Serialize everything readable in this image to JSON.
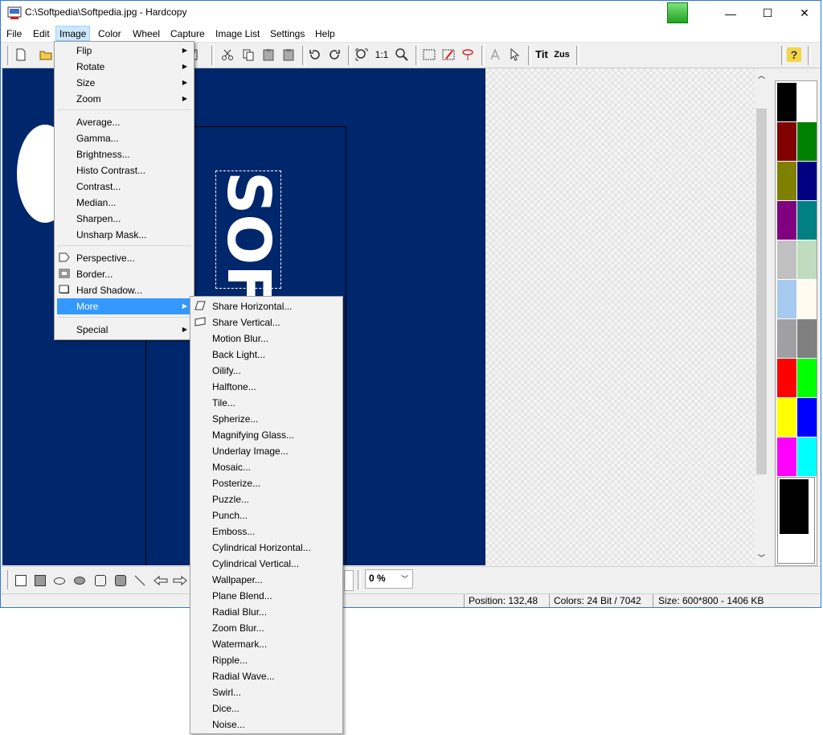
{
  "window": {
    "title": "C:\\Softpedia\\Softpedia.jpg - Hardcopy",
    "minimize": "—",
    "maximize": "☐",
    "close": "✕"
  },
  "menubar": [
    "File",
    "Edit",
    "Image",
    "Color",
    "Wheel",
    "Capture",
    "Image List",
    "Settings",
    "Help"
  ],
  "toolbar": {
    "zoom_1_1": "1:1",
    "tit_label": "Tit",
    "zus_label": "Zus",
    "help_icon": "?"
  },
  "image_menu": {
    "group1": [
      "Flip",
      "Rotate",
      "Size",
      "Zoom"
    ],
    "group2": [
      "Average...",
      "Gamma...",
      "Brightness...",
      "Histo Contrast...",
      "Contrast...",
      "Median...",
      "Sharpen...",
      "Unsharp Mask..."
    ],
    "group3": [
      "Perspective...",
      "Border...",
      "Hard Shadow...",
      "More"
    ],
    "group4": [
      "Special"
    ]
  },
  "more_submenu": [
    "Share Horizontal...",
    "Share Vertical...",
    "Motion Blur...",
    "Back Light...",
    "Oilify...",
    "Halftone...",
    "Tile...",
    "Spherize...",
    "Magnifying Glass...",
    "Underlay Image...",
    "Mosaic...",
    "Posterize...",
    "Puzzle...",
    "Punch...",
    "Emboss...",
    "Cylindrical Horizontal...",
    "Cylindrical Vertical...",
    "Wallpaper...",
    "Plane Blend...",
    "Radial Blur...",
    "Zoom Blur...",
    "Watermark...",
    "Ripple...",
    "Radial Wave...",
    "Swirl...",
    "Dice...",
    "Noise..."
  ],
  "canvas": {
    "logo_text": "SOF"
  },
  "bottom": {
    "zoom_value": "0 %"
  },
  "status": {
    "position": "Position: 132,48",
    "colors": "Colors: 24 Bit / 7042",
    "size": "Size: 600*800  -  1406 KB"
  },
  "palette_colors": [
    "#000000",
    "#ffffff",
    "#800000",
    "#008000",
    "#808000",
    "#000080",
    "#800080",
    "#008080",
    "#c0c0c0",
    "#c0dcc0",
    "#a6caf0",
    "#fffbf0",
    "#a0a0a4",
    "#808080",
    "#ff0000",
    "#00ff00",
    "#ffff00",
    "#0000ff",
    "#ff00ff",
    "#00ffff"
  ],
  "colors": {
    "image_bg": "#00266b",
    "highlight": "#3399ff"
  }
}
